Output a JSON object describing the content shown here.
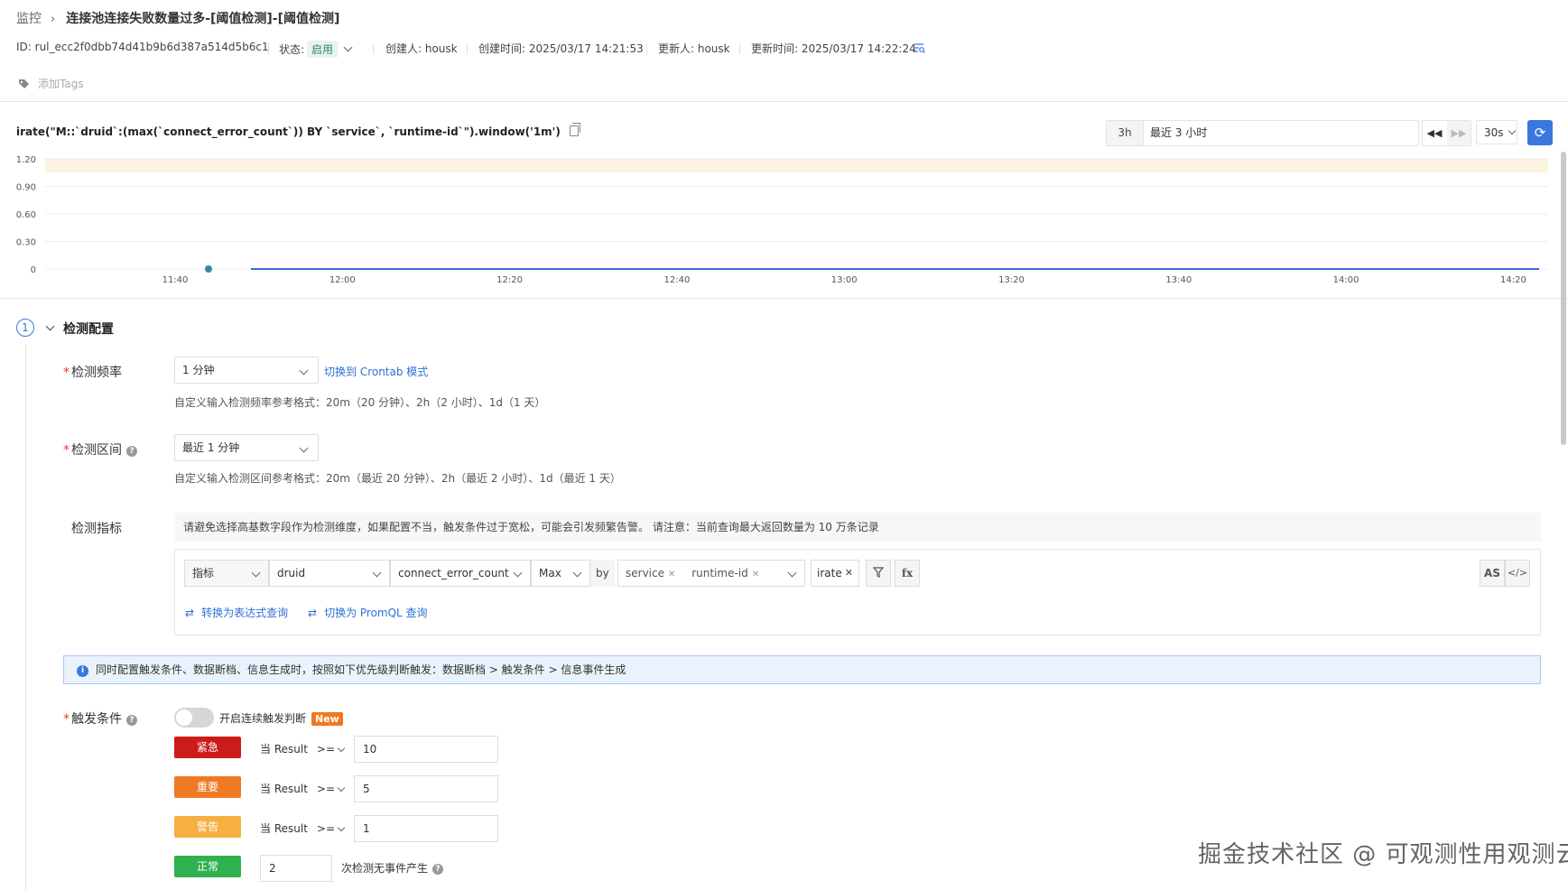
{
  "breadcrumb": {
    "root": "监控",
    "title": "连接池连接失败数量过多-[阈值检测]-[阈值检测]"
  },
  "meta": {
    "id": "ID: rul_ecc2f0dbb74d41b9b6d387a514d5b6c1",
    "status_label": "状态:",
    "status_value": "启用",
    "creator": "创建人: housk",
    "created_at": "创建时间: 2025/03/17 14:21:53",
    "updater": "更新人: housk",
    "updated_at": "更新时间: 2025/03/17 14:22:24"
  },
  "tags": {
    "placeholder": "添加Tags"
  },
  "query": {
    "text": "irate(\"M::`druid`:(max(`connect_error_count`)) BY `service`, `runtime-id`\").window('1m')"
  },
  "time_controls": {
    "range_short": "3h",
    "range_label": "最近 3 小时",
    "rewind": "◀◀",
    "forward": "▶▶",
    "refresh_interval": "30s"
  },
  "chart_data": {
    "type": "line",
    "y_ticks": [
      "1.20",
      "0.90",
      "0.60",
      "0.30",
      "0"
    ],
    "x_ticks": [
      "11:40",
      "12:00",
      "12:20",
      "12:40",
      "13:00",
      "13:20",
      "13:40",
      "14:00",
      "14:20"
    ],
    "ylim": [
      0,
      1.2
    ],
    "series": [
      {
        "values": [
          0,
          0,
          0,
          0,
          0,
          0,
          0,
          0,
          0
        ]
      }
    ],
    "threshold_band": {
      "from": 1.05,
      "to": 1.2,
      "color": "#fdf3e1"
    },
    "colors": {
      "line": "#3b68d8",
      "point": "#3a8a9a",
      "grid": "#ececec"
    }
  },
  "section": {
    "step": "1",
    "title": "检测配置"
  },
  "frequency": {
    "label": "检测频率",
    "value": "1 分钟",
    "crontab_link": "切换到 Crontab 模式",
    "hint": "自定义输入检测频率参考格式：20m（20 分钟）、2h（2 小时）、1d（1 天）"
  },
  "interval": {
    "label": "检测区间",
    "value": "最近 1 分钟",
    "hint": "自定义输入检测区间参考格式：20m（最近 20 分钟）、2h（最近 2 小时）、1d（最近 1 天）"
  },
  "metric": {
    "label": "检测指标",
    "warning": "请避免选择高基数字段作为检测维度，如果配置不当，触发条件过于宽松，可能会引发频繁告警。 请注意：当前查询最大返回数量为 10 万条记录",
    "source_type": "指标",
    "measurement": "druid",
    "field": "connect_error_count",
    "aggregation": "Max",
    "by_label": "by",
    "group_by": [
      "service",
      "runtime-id"
    ],
    "function": "irate",
    "fx_label": "fx",
    "as_label": "AS",
    "code_label": "</>",
    "convert_expression": "转换为表达式查询",
    "switch_promql": "切换为 PromQL 查询"
  },
  "info": {
    "text": "同时配置触发条件、数据断档、信息生成时，按照如下优先级判断触发：数据断档 > 触发条件 > 信息事件生成"
  },
  "trigger": {
    "label": "触发条件",
    "toggle_label": "开启连续触发判断",
    "new_badge": "New",
    "conditions": [
      {
        "level": "紧急",
        "color": "#cc1b1b",
        "prefix": "当 Result",
        "operator": ">=",
        "value": "10"
      },
      {
        "level": "重要",
        "color": "#f07a24",
        "prefix": "当 Result",
        "operator": ">=",
        "value": "5"
      },
      {
        "level": "警告",
        "color": "#f5b041",
        "prefix": "当 Result",
        "operator": ">=",
        "value": "1"
      }
    ],
    "normal": {
      "level": "正常",
      "color": "#2fb14e",
      "value": "2",
      "suffix": "次检测无事件产生"
    }
  },
  "watermark": "掘金技术社区 @ 可观测性用观测云"
}
